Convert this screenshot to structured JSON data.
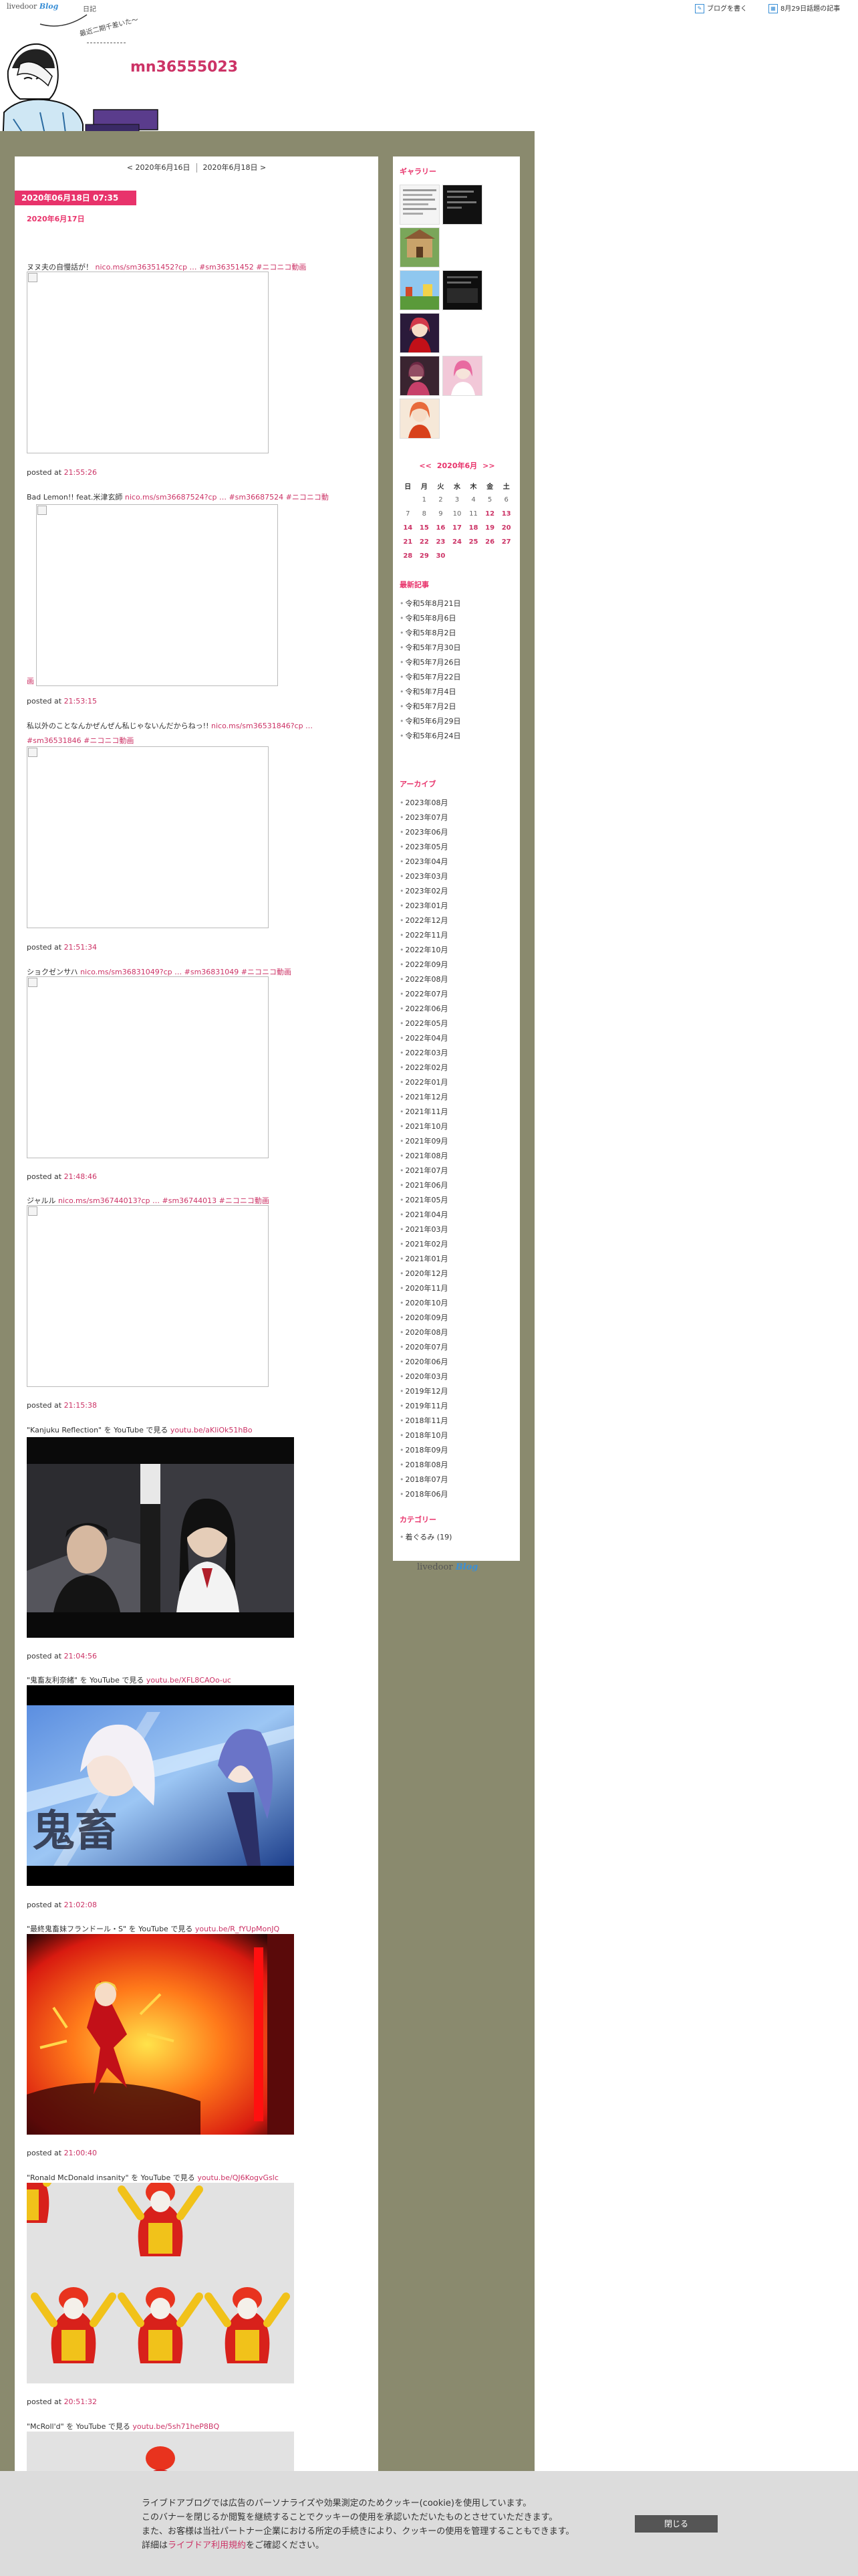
{
  "topbar": {
    "logo_text": "livedoor",
    "logo_blog": "Blog",
    "nikki": "日記",
    "write_blog": "ブログを書く",
    "trending": "8月29日話題の記事"
  },
  "header": {
    "title": "mn36555023",
    "scribble": "最近二期千差いた〜"
  },
  "nav": {
    "prev": "< 2020年6月16日",
    "next": "2020年6月18日 >"
  },
  "entry": {
    "date_badge": "2020年06月18日 07:35",
    "title": "2020年6月17日",
    "items": [
      {
        "text": "ヌヌ夫の自慢話が！",
        "link": "nico.ms/sm36351452?cp …",
        "tag1": "#sm36351452",
        "tag2": "#ニコニコ動画",
        "posted": "posted at",
        "time": "21:55:26"
      },
      {
        "text": "Bad Lemon!! feat.米津玄師",
        "link": "nico.ms/sm36687524?cp …",
        "tag1": "#sm36687524",
        "tag2": "#ニコニコ動",
        "tail": "画",
        "posted": "posted at",
        "time": "21:53:15"
      },
      {
        "text": "私以外のことなんかぜんぜん私じゃないんだからねっ!!",
        "link": "nico.ms/sm36531846?cp …",
        "tag1": "#sm36531846",
        "tag2": "#ニコニコ動画",
        "posted": "posted at",
        "time": "21:51:34"
      },
      {
        "text": "ショクゼンサハ",
        "link": "nico.ms/sm36831049?cp …",
        "tag1": "#sm36831049",
        "tag2": "#ニコニコ動画",
        "posted": "posted at",
        "time": "21:48:46"
      },
      {
        "text": "ジャルル",
        "link": "nico.ms/sm36744013?cp …",
        "tag1": "#sm36744013",
        "tag2": "#ニコニコ動画",
        "posted": "posted at",
        "time": "21:15:38"
      },
      {
        "text": "\"Kanjuku Reflection\" を YouTube で見る",
        "link": "youtu.be/aKliOk51hBo",
        "posted": "posted at",
        "time": "21:04:56"
      },
      {
        "text": "\"鬼畜友利奈緒\" を YouTube で見る",
        "link": "youtu.be/XFL8CAOo-uc",
        "overlay": "鬼畜",
        "posted": "posted at",
        "time": "21:02:08"
      },
      {
        "text": "\"最終鬼畜妹フランドール・S\" を YouTube で見る",
        "link": "youtu.be/R_fYUpMonJQ",
        "posted": "posted at",
        "time": "21:00:40"
      },
      {
        "text": "\"Ronald McDonald insanity\" を YouTube で見る",
        "link": "youtu.be/QJ6KogvGslc",
        "posted": "posted at",
        "time": "20:51:32"
      },
      {
        "text": "\"McRoll'd\" を YouTube で見る",
        "link": "youtu.be/5sh71heP8BQ"
      }
    ]
  },
  "sidebar": {
    "gallery_heading": "ギャラリー",
    "calendar": {
      "prev": "<<",
      "title": "2020年6月",
      "next": ">>",
      "weekdays": [
        "日",
        "月",
        "火",
        "水",
        "木",
        "金",
        "土"
      ],
      "weeks": [
        [
          "",
          "1",
          "2",
          "3",
          "4",
          "5",
          "6"
        ],
        [
          "7",
          "8",
          "9",
          "10",
          "11",
          "12",
          "13"
        ],
        [
          "14",
          "15",
          "16",
          "17",
          "18",
          "19",
          "20"
        ],
        [
          "21",
          "22",
          "23",
          "24",
          "25",
          "26",
          "27"
        ],
        [
          "28",
          "29",
          "30",
          "",
          "",
          "",
          ""
        ]
      ],
      "linked_days": [
        "12",
        "13",
        "14",
        "15",
        "16",
        "17",
        "18",
        "19",
        "20",
        "21",
        "22",
        "23",
        "24",
        "25",
        "26",
        "27",
        "28",
        "29",
        "30"
      ]
    },
    "recent_heading": "最新記事",
    "recent": [
      "令和5年8月21日",
      "令和5年8月6日",
      "令和5年8月2日",
      "令和5年7月30日",
      "令和5年7月26日",
      "令和5年7月22日",
      "令和5年7月4日",
      "令和5年7月2日",
      "令和5年6月29日",
      "令和5年6月24日"
    ],
    "archive_heading": "アーカイブ",
    "archives": [
      "2023年08月",
      "2023年07月",
      "2023年06月",
      "2023年05月",
      "2023年04月",
      "2023年03月",
      "2023年02月",
      "2023年01月",
      "2022年12月",
      "2022年11月",
      "2022年10月",
      "2022年09月",
      "2022年08月",
      "2022年07月",
      "2022年06月",
      "2022年05月",
      "2022年04月",
      "2022年03月",
      "2022年02月",
      "2022年01月",
      "2021年12月",
      "2021年11月",
      "2021年10月",
      "2021年09月",
      "2021年08月",
      "2021年07月",
      "2021年06月",
      "2021年05月",
      "2021年04月",
      "2021年03月",
      "2021年02月",
      "2021年01月",
      "2020年12月",
      "2020年11月",
      "2020年10月",
      "2020年09月",
      "2020年08月",
      "2020年07月",
      "2020年06月",
      "2020年03月",
      "2019年12月",
      "2019年11月",
      "2018年11月",
      "2018年10月",
      "2018年09月",
      "2018年08月",
      "2018年07月",
      "2018年06月"
    ],
    "category_heading": "カテゴリー",
    "categories": [
      "着ぐるみ (19)"
    ],
    "footer_logo": "livedoor",
    "footer_logo_blog": "Blog"
  },
  "cookie": {
    "line1": "ライブドアブログでは広告のパーソナライズや効果測定のためクッキー(cookie)を使用しています。",
    "line2": "このバナーを閉じるか閲覧を継続することでクッキーの使用を承認いただいたものとさせていただきます。",
    "line3": "また、お客様は当社パートナー企業における所定の手続きにより、クッキーの使用を管理することもできます。",
    "line4_pre": "詳細は",
    "line4_link": "ライブドア利用規約",
    "line4_post": "をご確認ください。",
    "close": "閉じる"
  },
  "colors": {
    "accent": "#e8336b",
    "link": "#cc3366",
    "frame": "#8a8a6e",
    "cookie_bg": "#dcdcdc"
  }
}
